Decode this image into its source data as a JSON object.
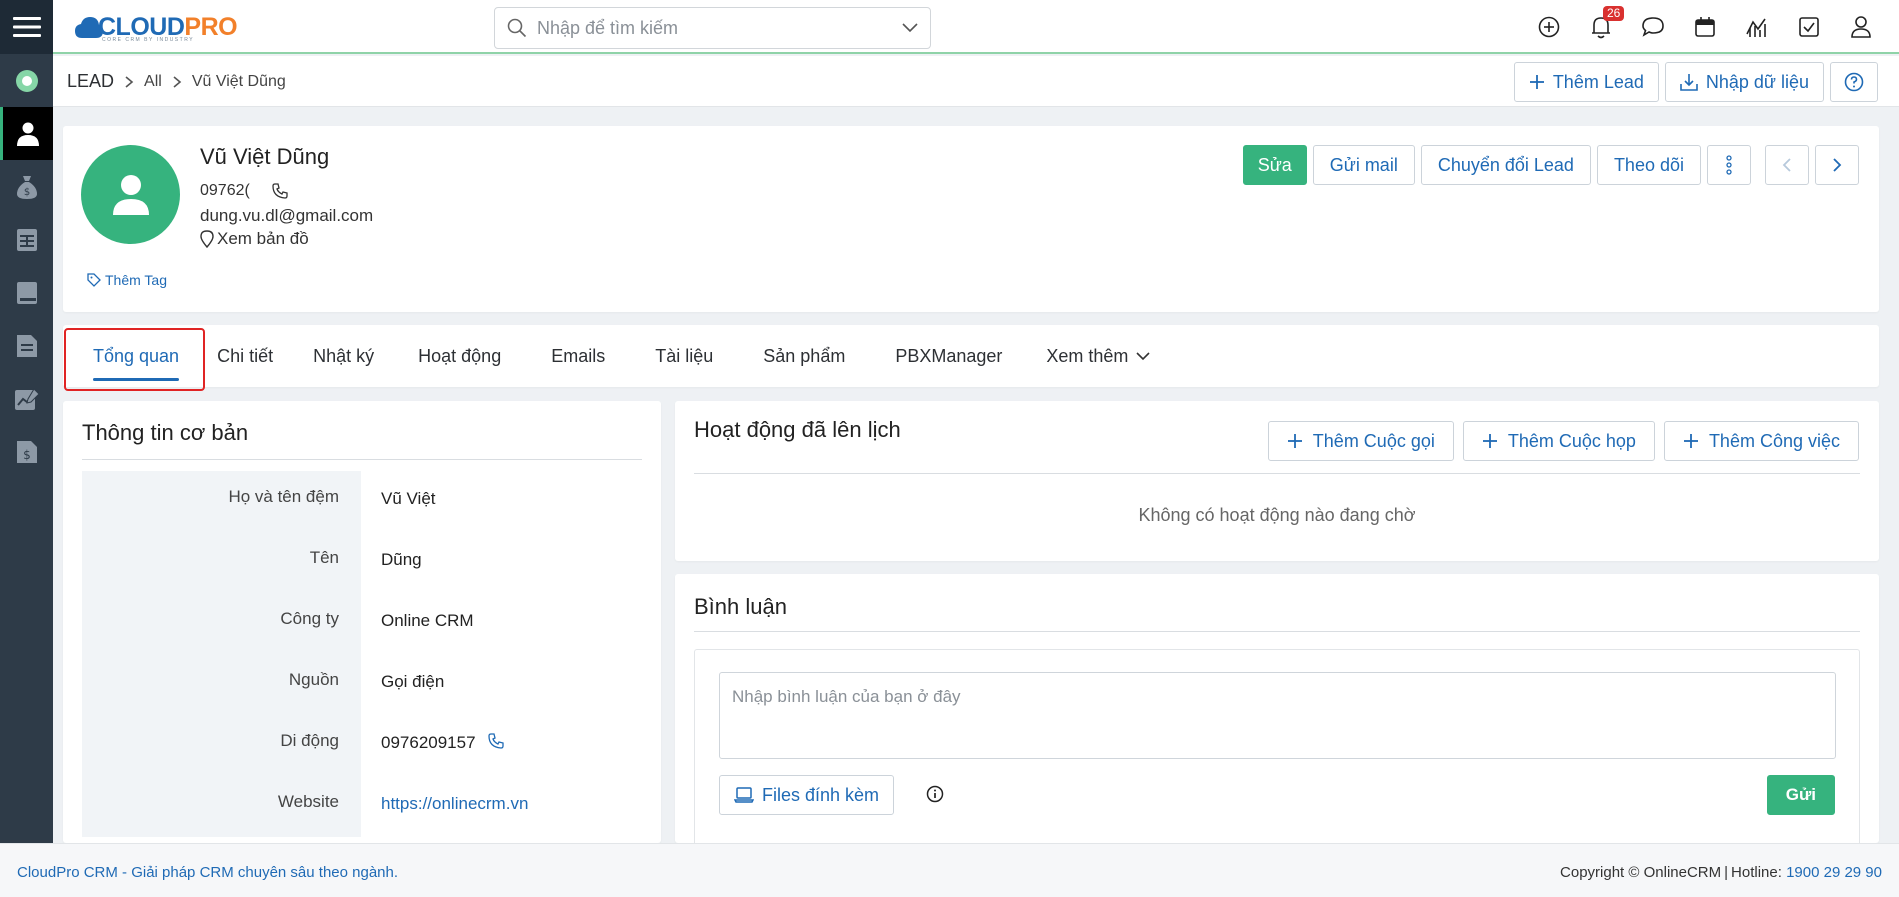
{
  "colors": {
    "brand_green": "#36b37e",
    "link_blue": "#1f6ab5",
    "sidebar_bg": "#2e3b48",
    "badge_red": "#d9312f",
    "highlight_red": "#e02424"
  },
  "header": {
    "logo_cloud": "CLOUD",
    "logo_pro": "PRO",
    "logo_tagline": "CORE CRM BY INDUSTRY",
    "search_placeholder": "Nhập để tìm kiếm",
    "notification_count": "26",
    "icons": [
      "add-icon",
      "bell-icon",
      "chat-icon",
      "calendar-icon",
      "chart-icon",
      "checkbox-icon",
      "user-icon"
    ]
  },
  "sidebar": {
    "items": [
      "home-icon",
      "contact-icon",
      "money-bag-icon",
      "spreadsheet-icon",
      "book-icon",
      "document-icon",
      "report-icon",
      "invoice-icon"
    ]
  },
  "breadcrumb": {
    "module": "LEAD",
    "filter": "All",
    "record": "Vũ Việt Dũng"
  },
  "subheader_actions": {
    "add_lead": "Thêm Lead",
    "import": "Nhập dữ liệu"
  },
  "profile": {
    "name": "Vũ Việt Dũng",
    "phone": "09762(",
    "email": "dung.vu.dl@gmail.com",
    "map_label": "Xem bản đồ",
    "add_tag": "Thêm Tag"
  },
  "profile_actions": {
    "edit": "Sửa",
    "send_mail": "Gửi mail",
    "convert": "Chuyển đổi Lead",
    "follow": "Theo dõi"
  },
  "tabs": [
    "Tổng quan",
    "Chi tiết",
    "Nhật ký",
    "Hoạt động",
    "Emails",
    "Tài liệu",
    "Sản phẩm",
    "PBXManager",
    "Xem thêm"
  ],
  "basic_info": {
    "title": "Thông tin cơ bản",
    "rows": [
      {
        "label": "Họ và tên đệm",
        "value": "Vũ Việt"
      },
      {
        "label": "Tên",
        "value": "Dũng"
      },
      {
        "label": "Công ty",
        "value": "Online CRM"
      },
      {
        "label": "Nguồn",
        "value": "Gọi điện"
      },
      {
        "label": "Di động",
        "value": "0976209157"
      },
      {
        "label": "Website",
        "value": "https://onlinecrm.vn"
      }
    ]
  },
  "scheduled": {
    "title": "Hoạt động đã lên lịch",
    "add_call": "Thêm Cuộc gọi",
    "add_meeting": "Thêm Cuộc họp",
    "add_task": "Thêm Công việc",
    "empty": "Không có hoạt động nào đang chờ"
  },
  "comments": {
    "title": "Bình luận",
    "placeholder": "Nhập bình luận của bạn ở đây",
    "attach": "Files đính kèm",
    "send": "Gửi"
  },
  "footer": {
    "left": "CloudPro CRM - Giải pháp CRM chuyên sâu theo ngành.",
    "copyright": "Copyright © OnlineCRM",
    "hotline_label": "Hotline:",
    "hotline": "1900 29 29 90"
  }
}
